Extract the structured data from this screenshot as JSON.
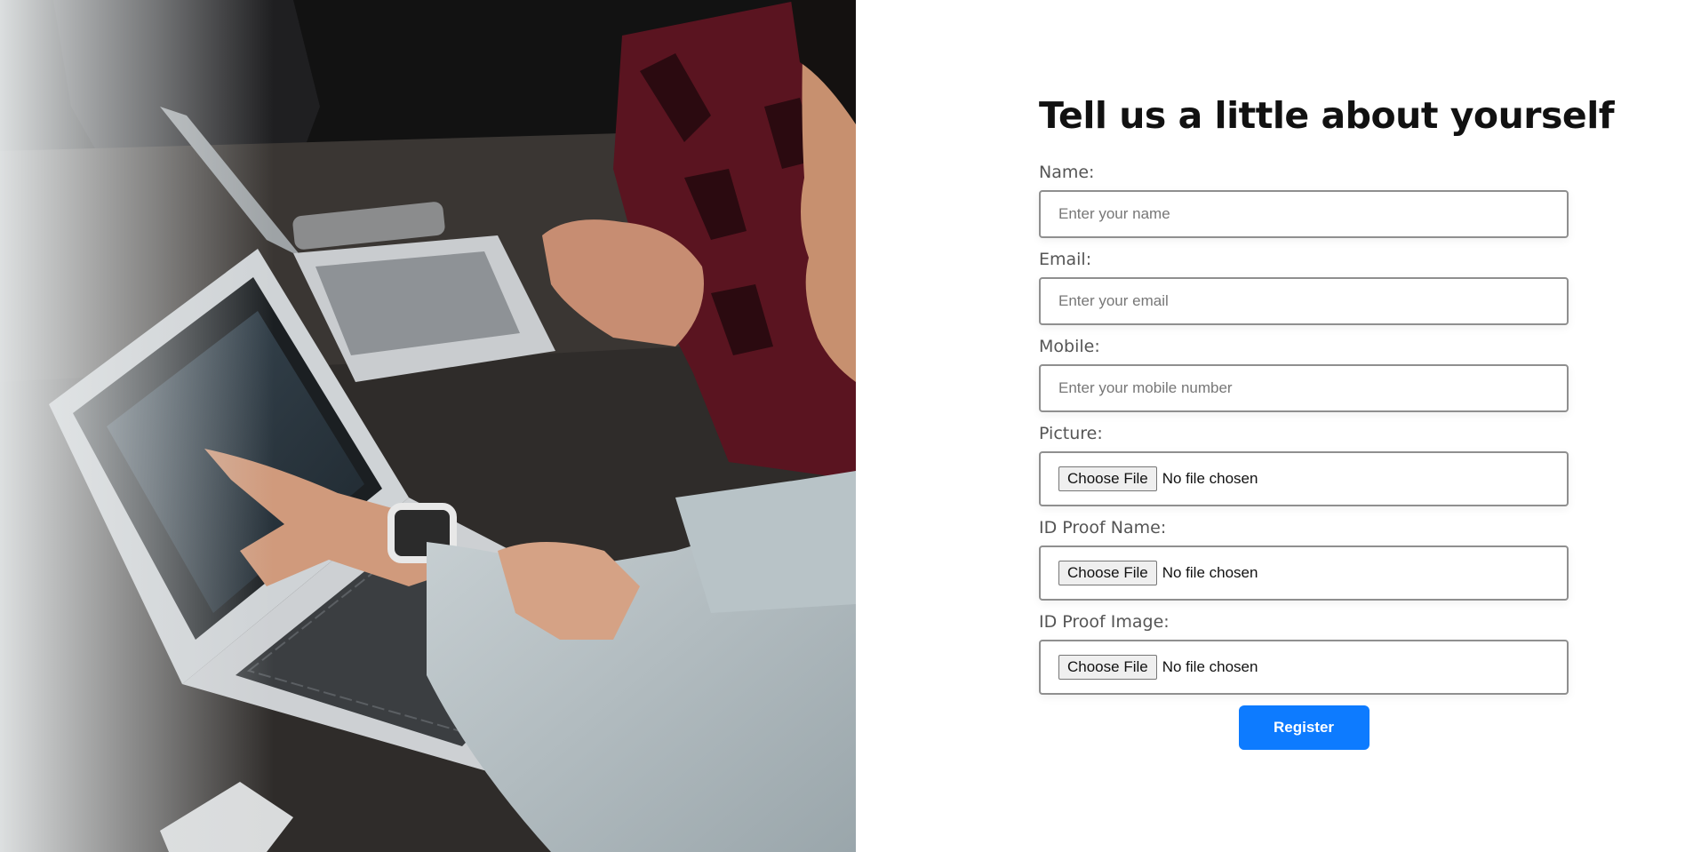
{
  "form": {
    "title": "Tell us a little about yourself",
    "fields": {
      "name": {
        "label": "Name:",
        "placeholder": "Enter your name"
      },
      "email": {
        "label": "Email:",
        "placeholder": "Enter your email"
      },
      "mobile": {
        "label": "Mobile:",
        "placeholder": "Enter your mobile number"
      },
      "picture": {
        "label": "Picture:",
        "button": "Choose File",
        "status": "No file chosen"
      },
      "id_proof_name": {
        "label": "ID Proof Name:",
        "button": "Choose File",
        "status": "No file chosen"
      },
      "id_proof_image": {
        "label": "ID Proof Image:",
        "button": "Choose File",
        "status": "No file chosen"
      }
    },
    "submit_label": "Register"
  },
  "colors": {
    "accent": "#0d7bff",
    "title_text": "#111111",
    "label_text": "#555555",
    "input_border": "#8f8f8f"
  }
}
